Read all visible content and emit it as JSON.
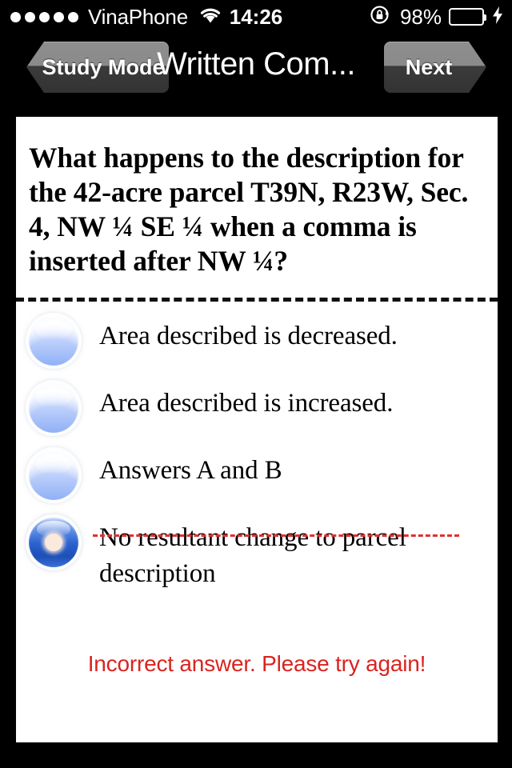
{
  "status_bar": {
    "signal_dots": 5,
    "signal_filled": 5,
    "carrier": "VinaPhone",
    "wifi_icon": "wifi-icon",
    "time": "14:26",
    "rotation_lock_icon": "rotation-lock-icon",
    "battery_percent": "98%",
    "battery_level": 98,
    "battery_color": "#4cd462",
    "charging_icon": "lightning-bolt-icon"
  },
  "nav_bar": {
    "back_label": "Study Mode",
    "title": "Written Com...",
    "next_label": "Next"
  },
  "card": {
    "question": "What happens to the description for the 42-acre parcel T39N, R23W, Sec. 4, NW ¼ SE ¼ when a comma is inserted after NW ¼?",
    "options": [
      {
        "label": "Area described is decreased.",
        "selected": false,
        "struck": false
      },
      {
        "label": "Area described is increased.",
        "selected": false,
        "struck": false
      },
      {
        "label": "Answers A and B",
        "selected": false,
        "struck": false
      },
      {
        "label": "No resultant change to parcel description",
        "selected": true,
        "struck": true
      }
    ],
    "feedback": "Incorrect answer. Please try again!",
    "feedback_color": "#d9241f",
    "strike_color": "#e03030"
  }
}
